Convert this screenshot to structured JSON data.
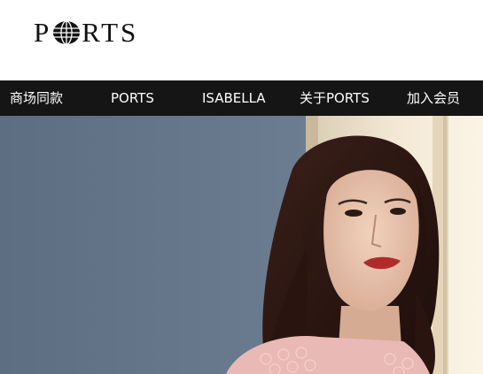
{
  "brand": {
    "logo_text": [
      "P",
      "RTS"
    ],
    "logo_full": "PORTS"
  },
  "nav": {
    "items": [
      {
        "label": "商场同款"
      },
      {
        "label": "PORTS"
      },
      {
        "label": "ISABELLA"
      },
      {
        "label": "关于PORTS"
      },
      {
        "label": "加入会员"
      }
    ]
  },
  "hero": {
    "image": "model-portrait",
    "colors": {
      "wall": "#6a7b8f",
      "window": "#efe3cd",
      "hair": "#2a1612",
      "lips": "#b02a2a"
    }
  }
}
